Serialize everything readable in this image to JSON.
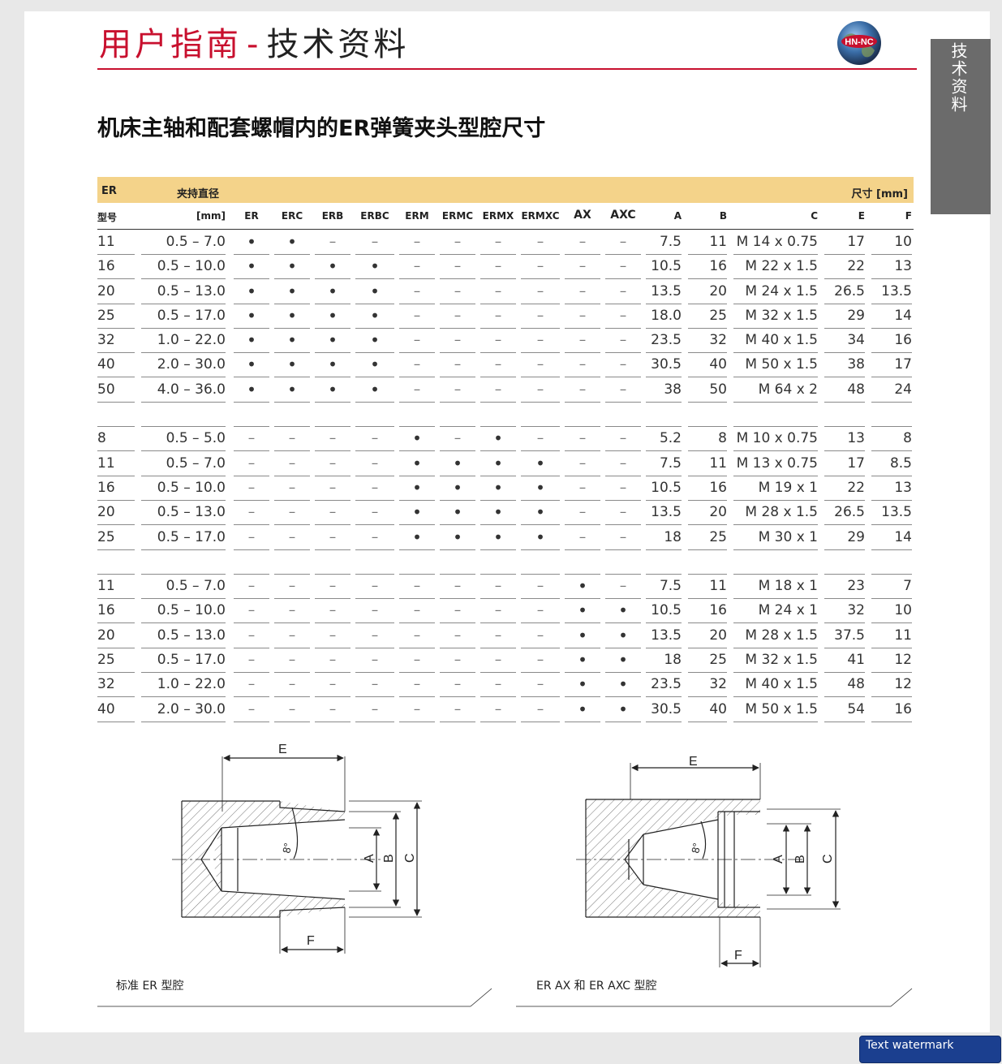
{
  "header": {
    "title_part1": "用户指南",
    "separator": "-",
    "title_part2": "技术资料",
    "logo_text": "HN-NC"
  },
  "side_tab": {
    "label": "技术资料"
  },
  "heading": "机床主轴和配套螺帽内的ER弹簧夹头型腔尺寸",
  "table": {
    "top_labels": {
      "er": "ER",
      "clamp": "夹持直径",
      "dims": "尺寸 [mm]"
    },
    "columns": [
      "型号",
      "[mm]",
      "ER",
      "ERC",
      "ERB",
      "ERBC",
      "ERM",
      "ERMC",
      "ERMX",
      "ERMXC",
      "AX",
      "AXC",
      "A",
      "B",
      "C",
      "E",
      "F"
    ],
    "groups": [
      [
        [
          "11",
          "0.5 – 7.0",
          "•",
          "•",
          "–",
          "–",
          "–",
          "–",
          "–",
          "–",
          "–",
          "–",
          "7.5",
          "11",
          "M 14 x 0.75",
          "17",
          "10"
        ],
        [
          "16",
          "0.5 – 10.0",
          "•",
          "•",
          "•",
          "•",
          "–",
          "–",
          "–",
          "–",
          "–",
          "–",
          "10.5",
          "16",
          "M 22 x 1.5",
          "22",
          "13"
        ],
        [
          "20",
          "0.5 – 13.0",
          "•",
          "•",
          "•",
          "•",
          "–",
          "–",
          "–",
          "–",
          "–",
          "–",
          "13.5",
          "20",
          "M 24 x 1.5",
          "26.5",
          "13.5"
        ],
        [
          "25",
          "0.5 – 17.0",
          "•",
          "•",
          "•",
          "•",
          "–",
          "–",
          "–",
          "–",
          "–",
          "–",
          "18.0",
          "25",
          "M 32 x 1.5",
          "29",
          "14"
        ],
        [
          "32",
          "1.0 – 22.0",
          "•",
          "•",
          "•",
          "•",
          "–",
          "–",
          "–",
          "–",
          "–",
          "–",
          "23.5",
          "32",
          "M 40 x 1.5",
          "34",
          "16"
        ],
        [
          "40",
          "2.0 – 30.0",
          "•",
          "•",
          "•",
          "•",
          "–",
          "–",
          "–",
          "–",
          "–",
          "–",
          "30.5",
          "40",
          "M 50 x 1.5",
          "38",
          "17"
        ],
        [
          "50",
          "4.0 – 36.0",
          "•",
          "•",
          "•",
          "•",
          "–",
          "–",
          "–",
          "–",
          "–",
          "–",
          "38",
          "50",
          "M 64 x 2",
          "48",
          "24"
        ]
      ],
      [
        [
          "8",
          "0.5 – 5.0",
          "–",
          "–",
          "–",
          "–",
          "•",
          "–",
          "•",
          "–",
          "–",
          "–",
          "5.2",
          "8",
          "M 10 x 0.75",
          "13",
          "8"
        ],
        [
          "11",
          "0.5 – 7.0",
          "–",
          "–",
          "–",
          "–",
          "•",
          "•",
          "•",
          "•",
          "–",
          "–",
          "7.5",
          "11",
          "M 13 x 0.75",
          "17",
          "8.5"
        ],
        [
          "16",
          "0.5 – 10.0",
          "–",
          "–",
          "–",
          "–",
          "•",
          "•",
          "•",
          "•",
          "–",
          "–",
          "10.5",
          "16",
          "M 19 x 1",
          "22",
          "13"
        ],
        [
          "20",
          "0.5 – 13.0",
          "–",
          "–",
          "–",
          "–",
          "•",
          "•",
          "•",
          "•",
          "–",
          "–",
          "13.5",
          "20",
          "M 28 x 1.5",
          "26.5",
          "13.5"
        ],
        [
          "25",
          "0.5 – 17.0",
          "–",
          "–",
          "–",
          "–",
          "•",
          "•",
          "•",
          "•",
          "–",
          "–",
          "18",
          "25",
          "M 30 x 1",
          "29",
          "14"
        ]
      ],
      [
        [
          "11",
          "0.5 – 7.0",
          "–",
          "–",
          "–",
          "–",
          "–",
          "–",
          "–",
          "–",
          "•",
          "–",
          "7.5",
          "11",
          "M 18 x 1",
          "23",
          "7"
        ],
        [
          "16",
          "0.5 – 10.0",
          "–",
          "–",
          "–",
          "–",
          "–",
          "–",
          "–",
          "–",
          "•",
          "•",
          "10.5",
          "16",
          "M 24 x 1",
          "32",
          "10"
        ],
        [
          "20",
          "0.5 – 13.0",
          "–",
          "–",
          "–",
          "–",
          "–",
          "–",
          "–",
          "–",
          "•",
          "•",
          "13.5",
          "20",
          "M 28 x 1.5",
          "37.5",
          "11"
        ],
        [
          "25",
          "0.5 – 17.0",
          "–",
          "–",
          "–",
          "–",
          "–",
          "–",
          "–",
          "–",
          "•",
          "•",
          "18",
          "25",
          "M 32 x 1.5",
          "41",
          "12"
        ],
        [
          "32",
          "1.0 – 22.0",
          "–",
          "–",
          "–",
          "–",
          "–",
          "–",
          "–",
          "–",
          "•",
          "•",
          "23.5",
          "32",
          "M 40 x 1.5",
          "48",
          "12"
        ],
        [
          "40",
          "2.0 – 30.0",
          "–",
          "–",
          "–",
          "–",
          "–",
          "–",
          "–",
          "–",
          "•",
          "•",
          "30.5",
          "40",
          "M 50 x 1.5",
          "54",
          "16"
        ]
      ]
    ]
  },
  "diagrams": {
    "left": {
      "caption": "标准 ER 型腔",
      "labels": {
        "E": "E",
        "F": "F",
        "A": "A",
        "B": "B",
        "C": "C",
        "angle": "8°"
      }
    },
    "right": {
      "caption": "ER AX 和 ER AXC 型腔",
      "labels": {
        "E": "E",
        "F": "F",
        "A": "A",
        "B": "B",
        "C": "C",
        "angle": "8°"
      }
    }
  },
  "watermark": "Text watermark"
}
